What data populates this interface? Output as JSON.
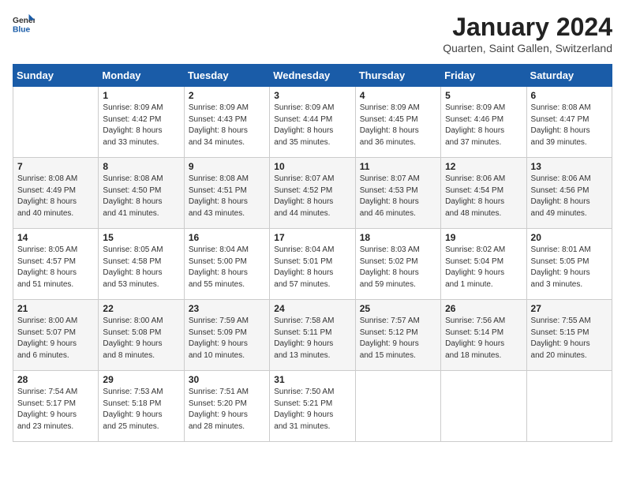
{
  "logo": {
    "general": "General",
    "blue": "Blue"
  },
  "header": {
    "month_year": "January 2024",
    "location": "Quarten, Saint Gallen, Switzerland"
  },
  "days_of_week": [
    "Sunday",
    "Monday",
    "Tuesday",
    "Wednesday",
    "Thursday",
    "Friday",
    "Saturday"
  ],
  "weeks": [
    [
      {
        "day": "",
        "info": ""
      },
      {
        "day": "1",
        "info": "Sunrise: 8:09 AM\nSunset: 4:42 PM\nDaylight: 8 hours\nand 33 minutes."
      },
      {
        "day": "2",
        "info": "Sunrise: 8:09 AM\nSunset: 4:43 PM\nDaylight: 8 hours\nand 34 minutes."
      },
      {
        "day": "3",
        "info": "Sunrise: 8:09 AM\nSunset: 4:44 PM\nDaylight: 8 hours\nand 35 minutes."
      },
      {
        "day": "4",
        "info": "Sunrise: 8:09 AM\nSunset: 4:45 PM\nDaylight: 8 hours\nand 36 minutes."
      },
      {
        "day": "5",
        "info": "Sunrise: 8:09 AM\nSunset: 4:46 PM\nDaylight: 8 hours\nand 37 minutes."
      },
      {
        "day": "6",
        "info": "Sunrise: 8:08 AM\nSunset: 4:47 PM\nDaylight: 8 hours\nand 39 minutes."
      }
    ],
    [
      {
        "day": "7",
        "info": "Sunrise: 8:08 AM\nSunset: 4:49 PM\nDaylight: 8 hours\nand 40 minutes."
      },
      {
        "day": "8",
        "info": "Sunrise: 8:08 AM\nSunset: 4:50 PM\nDaylight: 8 hours\nand 41 minutes."
      },
      {
        "day": "9",
        "info": "Sunrise: 8:08 AM\nSunset: 4:51 PM\nDaylight: 8 hours\nand 43 minutes."
      },
      {
        "day": "10",
        "info": "Sunrise: 8:07 AM\nSunset: 4:52 PM\nDaylight: 8 hours\nand 44 minutes."
      },
      {
        "day": "11",
        "info": "Sunrise: 8:07 AM\nSunset: 4:53 PM\nDaylight: 8 hours\nand 46 minutes."
      },
      {
        "day": "12",
        "info": "Sunrise: 8:06 AM\nSunset: 4:54 PM\nDaylight: 8 hours\nand 48 minutes."
      },
      {
        "day": "13",
        "info": "Sunrise: 8:06 AM\nSunset: 4:56 PM\nDaylight: 8 hours\nand 49 minutes."
      }
    ],
    [
      {
        "day": "14",
        "info": "Sunrise: 8:05 AM\nSunset: 4:57 PM\nDaylight: 8 hours\nand 51 minutes."
      },
      {
        "day": "15",
        "info": "Sunrise: 8:05 AM\nSunset: 4:58 PM\nDaylight: 8 hours\nand 53 minutes."
      },
      {
        "day": "16",
        "info": "Sunrise: 8:04 AM\nSunset: 5:00 PM\nDaylight: 8 hours\nand 55 minutes."
      },
      {
        "day": "17",
        "info": "Sunrise: 8:04 AM\nSunset: 5:01 PM\nDaylight: 8 hours\nand 57 minutes."
      },
      {
        "day": "18",
        "info": "Sunrise: 8:03 AM\nSunset: 5:02 PM\nDaylight: 8 hours\nand 59 minutes."
      },
      {
        "day": "19",
        "info": "Sunrise: 8:02 AM\nSunset: 5:04 PM\nDaylight: 9 hours\nand 1 minute."
      },
      {
        "day": "20",
        "info": "Sunrise: 8:01 AM\nSunset: 5:05 PM\nDaylight: 9 hours\nand 3 minutes."
      }
    ],
    [
      {
        "day": "21",
        "info": "Sunrise: 8:00 AM\nSunset: 5:07 PM\nDaylight: 9 hours\nand 6 minutes."
      },
      {
        "day": "22",
        "info": "Sunrise: 8:00 AM\nSunset: 5:08 PM\nDaylight: 9 hours\nand 8 minutes."
      },
      {
        "day": "23",
        "info": "Sunrise: 7:59 AM\nSunset: 5:09 PM\nDaylight: 9 hours\nand 10 minutes."
      },
      {
        "day": "24",
        "info": "Sunrise: 7:58 AM\nSunset: 5:11 PM\nDaylight: 9 hours\nand 13 minutes."
      },
      {
        "day": "25",
        "info": "Sunrise: 7:57 AM\nSunset: 5:12 PM\nDaylight: 9 hours\nand 15 minutes."
      },
      {
        "day": "26",
        "info": "Sunrise: 7:56 AM\nSunset: 5:14 PM\nDaylight: 9 hours\nand 18 minutes."
      },
      {
        "day": "27",
        "info": "Sunrise: 7:55 AM\nSunset: 5:15 PM\nDaylight: 9 hours\nand 20 minutes."
      }
    ],
    [
      {
        "day": "28",
        "info": "Sunrise: 7:54 AM\nSunset: 5:17 PM\nDaylight: 9 hours\nand 23 minutes."
      },
      {
        "day": "29",
        "info": "Sunrise: 7:53 AM\nSunset: 5:18 PM\nDaylight: 9 hours\nand 25 minutes."
      },
      {
        "day": "30",
        "info": "Sunrise: 7:51 AM\nSunset: 5:20 PM\nDaylight: 9 hours\nand 28 minutes."
      },
      {
        "day": "31",
        "info": "Sunrise: 7:50 AM\nSunset: 5:21 PM\nDaylight: 9 hours\nand 31 minutes."
      },
      {
        "day": "",
        "info": ""
      },
      {
        "day": "",
        "info": ""
      },
      {
        "day": "",
        "info": ""
      }
    ]
  ]
}
